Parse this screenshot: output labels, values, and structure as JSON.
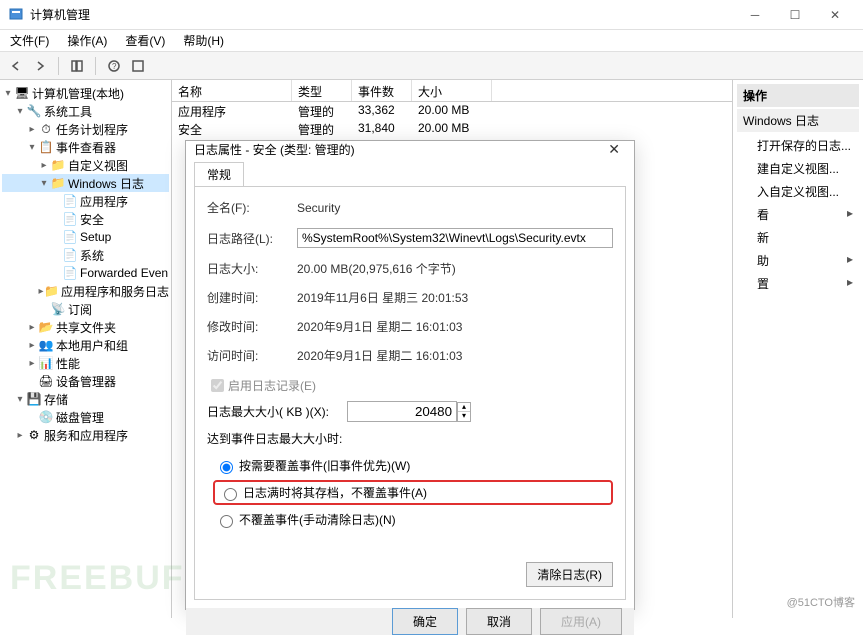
{
  "window": {
    "title": "计算机管理"
  },
  "menu": {
    "file": "文件(F)",
    "action": "操作(A)",
    "view": "查看(V)",
    "help": "帮助(H)"
  },
  "tree": {
    "root": "计算机管理(本地)",
    "systools": "系统工具",
    "tasksched": "任务计划程序",
    "eventviewer": "事件查看器",
    "customviews": "自定义视图",
    "winlogs": "Windows 日志",
    "app": "应用程序",
    "security": "安全",
    "setup": "Setup",
    "system": "系统",
    "forwarded": "Forwarded Even",
    "appservices": "应用程序和服务日志",
    "subscribe": "订阅",
    "shared": "共享文件夹",
    "localusers": "本地用户和组",
    "perf": "性能",
    "devmgr": "设备管理器",
    "storage": "存储",
    "diskmgr": "磁盘管理",
    "servapp": "服务和应用程序"
  },
  "list": {
    "hdr": {
      "name": "名称",
      "type": "类型",
      "count": "事件数",
      "size": "大小"
    },
    "rows": [
      {
        "name": "应用程序",
        "type": "管理的",
        "count": "33,362",
        "size": "20.00 MB"
      },
      {
        "name": "安全",
        "type": "管理的",
        "count": "31,840",
        "size": "20.00 MB"
      }
    ]
  },
  "actions": {
    "header": "操作",
    "group": "Windows 日志",
    "items": [
      "打开保存的日志...",
      "建自定义视图...",
      "入自定义视图...",
      "看",
      "新",
      "助",
      "置"
    ]
  },
  "dialog": {
    "title": "日志属性 - 安全 (类型: 管理的)",
    "tab": "常规",
    "labels": {
      "fullname": "全名(F):",
      "logpath": "日志路径(L):",
      "logsize": "日志大小:",
      "created": "创建时间:",
      "modified": "修改时间:",
      "accessed": "访问时间:",
      "enable": "启用日志记录(E)",
      "maxsize": "日志最大大小( KB )(X):",
      "whenmax": "达到事件日志最大大小时:",
      "r1": "按需要覆盖事件(旧事件优先)(W)",
      "r2": "日志满时将其存档，不覆盖事件(A)",
      "r3": "不覆盖事件(手动清除日志)(N)",
      "clear": "清除日志(R)"
    },
    "vals": {
      "fullname": "Security",
      "logpath": "%SystemRoot%\\System32\\Winevt\\Logs\\Security.evtx",
      "logsize": "20.00 MB(20,975,616 个字节)",
      "created": "2019年11月6日 星期三 20:01:53",
      "modified": "2020年9月1日 星期二 16:01:03",
      "accessed": "2020年9月1日 星期二 16:01:03",
      "maxsize": "20480"
    },
    "buttons": {
      "ok": "确定",
      "cancel": "取消",
      "apply": "应用(A)"
    }
  },
  "watermark": "FREEBUF",
  "watermark2": "@51CTO博客"
}
